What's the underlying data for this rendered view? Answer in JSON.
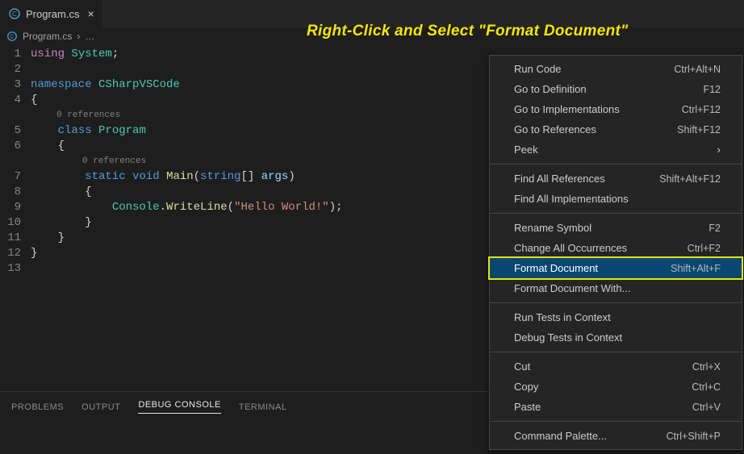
{
  "tab": {
    "filename": "Program.cs"
  },
  "breadcrumb": {
    "filename": "Program.cs",
    "sep": "›",
    "trail": "…"
  },
  "annotation": "Right-Click and Select \"Format Document\"",
  "gutter": [
    "1",
    "2",
    "3",
    "4",
    "5",
    "6",
    "7",
    "8",
    "9",
    "10",
    "11",
    "12",
    "13"
  ],
  "code": {
    "l1": {
      "using": "using",
      "sp": " ",
      "sys": "System",
      "semi": ";"
    },
    "l3": {
      "ns": "namespace",
      "sp": " ",
      "name": "CSharpVSCode"
    },
    "l4": {
      "brace": "{"
    },
    "ref0a": "0 references",
    "l5": {
      "indent": "    ",
      "cls": "class",
      "sp": " ",
      "name": "Program"
    },
    "l6": {
      "indent": "    ",
      "brace": "{"
    },
    "ref0b": "0 references",
    "l7": {
      "indent": "        ",
      "static": "static",
      "sp": " ",
      "void": "void",
      "sp2": " ",
      "main": "Main",
      "op": "(",
      "string": "string",
      "arr": "[] ",
      "args": "args",
      "cp": ")"
    },
    "l8": {
      "indent": "        ",
      "brace": "{"
    },
    "l9": {
      "indent": "            ",
      "console": "Console",
      "dot": ".",
      "wl": "WriteLine",
      "op": "(",
      "str": "\"Hello World!\"",
      "cp": ")",
      "semi": ";"
    },
    "l10": {
      "indent": "        ",
      "brace": "}"
    },
    "l11": {
      "indent": "    ",
      "brace": "}"
    },
    "l12": {
      "brace": "}"
    }
  },
  "panel": {
    "tabs": [
      "PROBLEMS",
      "OUTPUT",
      "DEBUG CONSOLE",
      "TERMINAL"
    ],
    "activeIndex": 2
  },
  "menu": {
    "groups": [
      [
        {
          "label": "Run Code",
          "shortcut": "Ctrl+Alt+N"
        },
        {
          "label": "Go to Definition",
          "shortcut": "F12"
        },
        {
          "label": "Go to Implementations",
          "shortcut": "Ctrl+F12"
        },
        {
          "label": "Go to References",
          "shortcut": "Shift+F12"
        },
        {
          "label": "Peek",
          "submenu": true
        }
      ],
      [
        {
          "label": "Find All References",
          "shortcut": "Shift+Alt+F12"
        },
        {
          "label": "Find All Implementations"
        }
      ],
      [
        {
          "label": "Rename Symbol",
          "shortcut": "F2"
        },
        {
          "label": "Change All Occurrences",
          "shortcut": "Ctrl+F2"
        },
        {
          "label": "Format Document",
          "shortcut": "Shift+Alt+F",
          "highlighted": true
        },
        {
          "label": "Format Document With..."
        }
      ],
      [
        {
          "label": "Run Tests in Context"
        },
        {
          "label": "Debug Tests in Context"
        }
      ],
      [
        {
          "label": "Cut",
          "shortcut": "Ctrl+X"
        },
        {
          "label": "Copy",
          "shortcut": "Ctrl+C"
        },
        {
          "label": "Paste",
          "shortcut": "Ctrl+V"
        }
      ],
      [
        {
          "label": "Command Palette...",
          "shortcut": "Ctrl+Shift+P"
        }
      ]
    ]
  }
}
